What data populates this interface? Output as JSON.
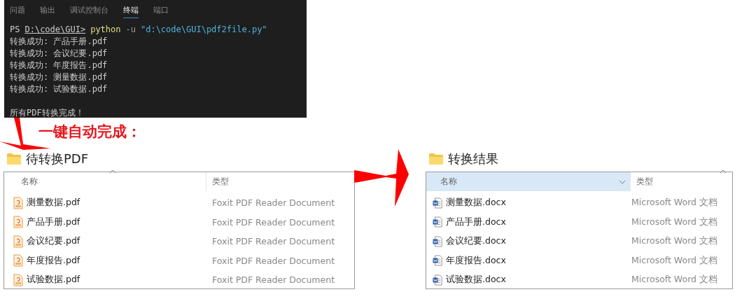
{
  "terminal": {
    "tabs": [
      {
        "label": "问题",
        "selected": false
      },
      {
        "label": "输出",
        "selected": false
      },
      {
        "label": "调试控制台",
        "selected": false
      },
      {
        "label": "终端",
        "selected": true
      },
      {
        "label": "端口",
        "selected": false
      }
    ],
    "prompt": {
      "ps": "PS",
      "path": "D:\\code\\GUI>",
      "command": "python",
      "flag": "-u",
      "argument": "\"d:\\code\\GUI\\pdf2file.py\""
    },
    "output_lines": [
      "转换成功: 产品手册.pdf",
      "转换成功: 会议纪要.pdf",
      "转换成功: 年度报告.pdf",
      "转换成功: 测量数据.pdf",
      "转换成功: 试验数据.pdf"
    ],
    "summary": "所有PDF转换完成！"
  },
  "caption": "一键自动完成：",
  "panels": [
    {
      "title": "待转换PDF",
      "kind": "pdf",
      "header_highlighted": false,
      "columns": [
        "名称",
        "类型"
      ],
      "files": [
        {
          "name": "测量数据.pdf",
          "type": "Foxit PDF Reader Document"
        },
        {
          "name": "产品手册.pdf",
          "type": "Foxit PDF Reader Document"
        },
        {
          "name": "会议纪要.pdf",
          "type": "Foxit PDF Reader Document"
        },
        {
          "name": "年度报告.pdf",
          "type": "Foxit PDF Reader Document"
        },
        {
          "name": "试验数据.pdf",
          "type": "Foxit PDF Reader Document"
        }
      ]
    },
    {
      "title": "转换结果",
      "kind": "docx",
      "header_highlighted": true,
      "columns": [
        "名称",
        "类型"
      ],
      "files": [
        {
          "name": "测量数据.docx",
          "type": "Microsoft Word 文档"
        },
        {
          "name": "产品手册.docx",
          "type": "Microsoft Word 文档"
        },
        {
          "name": "会议纪要.docx",
          "type": "Microsoft Word 文档"
        },
        {
          "name": "年度报告.docx",
          "type": "Microsoft Word 文档"
        },
        {
          "name": "试验数据.docx",
          "type": "Microsoft Word 文档"
        }
      ]
    }
  ]
}
